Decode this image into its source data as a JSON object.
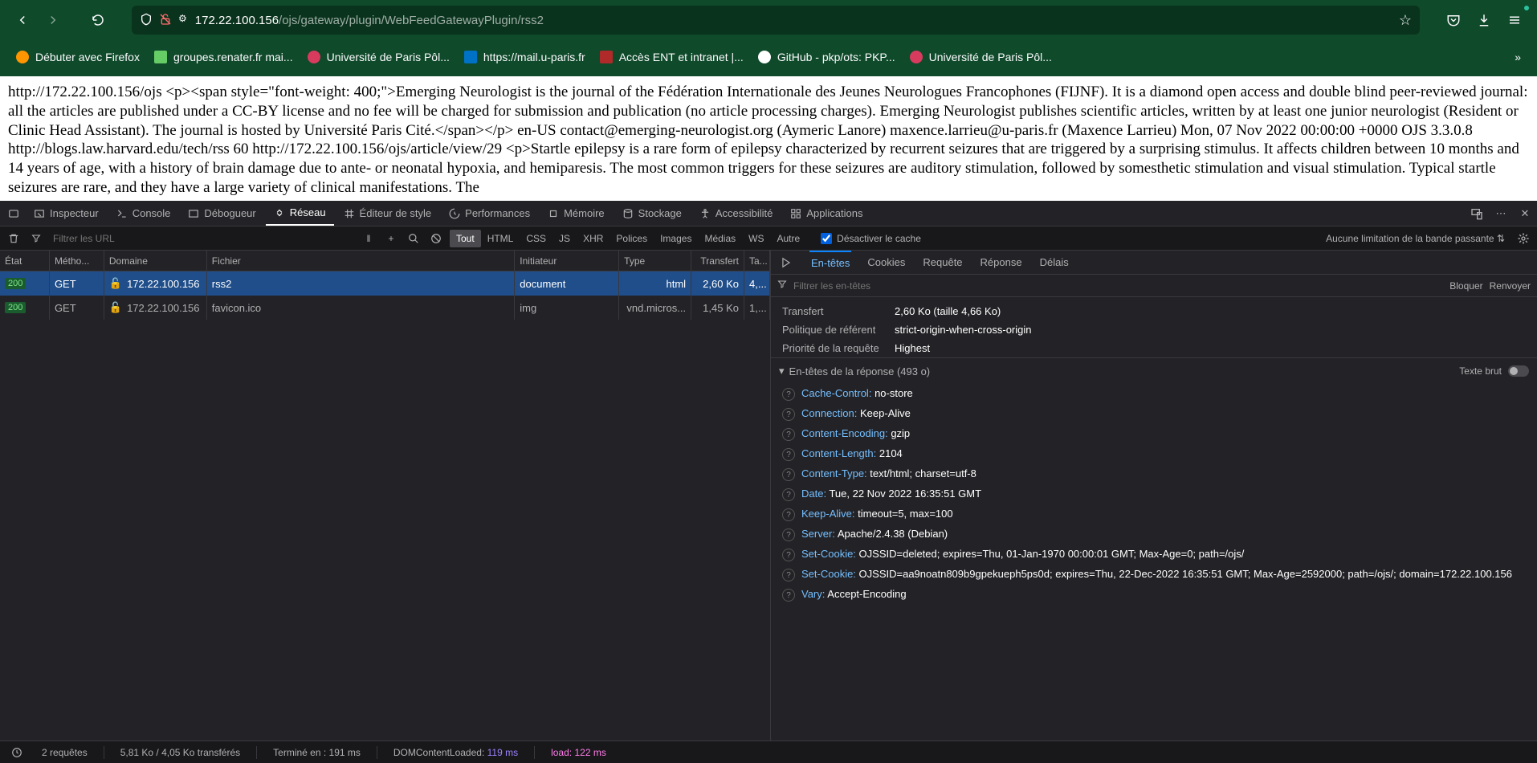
{
  "nav": {
    "url_host": "172.22.100.156",
    "url_path": "/ojs/gateway/plugin/WebFeedGatewayPlugin/rss2"
  },
  "bookmarks": [
    {
      "label": "Débuter avec Firefox",
      "color": "#ff9500"
    },
    {
      "label": "groupes.renater.fr mai...",
      "color": "#66cc66"
    },
    {
      "label": "Université de Paris Pôl...",
      "color": "#d83b5e"
    },
    {
      "label": "https://mail.u-paris.fr",
      "color": "#0072c6"
    },
    {
      "label": "Accès ENT et intranet |...",
      "color": "#b02a2a"
    },
    {
      "label": "GitHub - pkp/ots: PKP...",
      "color": "#24292e"
    },
    {
      "label": "Université de Paris Pôl...",
      "color": "#d83b5e"
    }
  ],
  "page_text": "http://172.22.100.156/ojs <p><span style=\"font-weight: 400;\">Emerging Neurologist is the journal of the Fédération Internationale des Jeunes Neurologues Francophones (FIJNF). It is a diamond open access and double blind peer-reviewed journal: all the articles are published under a CC-BY license and no fee will be charged for submission and publication (no article processing charges). Emerging Neurologist publishes scientific articles, written by at least one junior neurologist (Resident or Clinic Head Assistant). The journal is hosted by Université Paris Cité.</span></p> en-US contact@emerging-neurologist.org (Aymeric Lanore) maxence.larrieu@u-paris.fr (Maxence Larrieu) Mon, 07 Nov 2022 00:00:00 +0000 OJS 3.3.0.8 http://blogs.law.harvard.edu/tech/rss 60 http://172.22.100.156/ojs/article/view/29 <p>Startle epilepsy is a rare form of epilepsy characterized by recurrent seizures that are triggered by a surprising stimulus. It affects children between 10 months and 14 years of age, with a history of brain damage due to ante- or neonatal hypoxia, and hemiparesis. The most common triggers for these seizures are auditory stimulation, followed by somesthetic stimulation and visual stimulation. Typical startle seizures are rare, and they have a large variety of clinical manifestations. The",
  "dt_tabs": {
    "inspector": "Inspecteur",
    "console": "Console",
    "debugger": "Débogueur",
    "network": "Réseau",
    "style": "Éditeur de style",
    "perf": "Performances",
    "memory": "Mémoire",
    "storage": "Stockage",
    "a11y": "Accessibilité",
    "apps": "Applications"
  },
  "toolbar": {
    "filter_placeholder": "Filtrer les URL",
    "types": [
      "Tout",
      "HTML",
      "CSS",
      "JS",
      "XHR",
      "Polices",
      "Images",
      "Médias",
      "WS",
      "Autre"
    ],
    "disable_cache": "Désactiver le cache",
    "throttle": "Aucune limitation de la bande passante"
  },
  "columns": {
    "status": "État",
    "method": "Métho...",
    "domain": "Domaine",
    "file": "Fichier",
    "initiator": "Initiateur",
    "type": "Type",
    "transfer": "Transfert",
    "size": "Ta..."
  },
  "requests": [
    {
      "status": "200",
      "method": "GET",
      "domain": "172.22.100.156",
      "file": "rss2",
      "initiator": "document",
      "type": "html",
      "transfer": "2,60 Ko",
      "size": "4,..."
    },
    {
      "status": "200",
      "method": "GET",
      "domain": "172.22.100.156",
      "file": "favicon.ico",
      "initiator": "img",
      "type": "vnd.micros...",
      "transfer": "1,45 Ko",
      "size": "1,..."
    }
  ],
  "details": {
    "tabs": {
      "headers": "En-têtes",
      "cookies": "Cookies",
      "request": "Requête",
      "response": "Réponse",
      "timing": "Délais"
    },
    "filter_placeholder": "Filtrer les en-têtes",
    "block": "Bloquer",
    "resend": "Renvoyer",
    "summary": {
      "transfer_label": "Transfert",
      "transfer_value": "2,60 Ko (taille 4,66 Ko)",
      "referrer_label": "Politique de référent",
      "referrer_value": "strict-origin-when-cross-origin",
      "priority_label": "Priorité de la requête",
      "priority_value": "Highest"
    },
    "response_section": "En-têtes de la réponse (493 o)",
    "raw_label": "Texte brut",
    "headers": [
      {
        "name": "Cache-Control:",
        "value": "no-store"
      },
      {
        "name": "Connection:",
        "value": "Keep-Alive"
      },
      {
        "name": "Content-Encoding:",
        "value": "gzip"
      },
      {
        "name": "Content-Length:",
        "value": "2104"
      },
      {
        "name": "Content-Type:",
        "value": "text/html; charset=utf-8"
      },
      {
        "name": "Date:",
        "value": "Tue, 22 Nov 2022 16:35:51 GMT"
      },
      {
        "name": "Keep-Alive:",
        "value": "timeout=5, max=100"
      },
      {
        "name": "Server:",
        "value": "Apache/2.4.38 (Debian)"
      },
      {
        "name": "Set-Cookie:",
        "value": "OJSSID=deleted; expires=Thu, 01-Jan-1970 00:00:01 GMT; Max-Age=0; path=/ojs/"
      },
      {
        "name": "Set-Cookie:",
        "value": "OJSSID=aa9noatn809b9gpekueph5ps0d; expires=Thu, 22-Dec-2022 16:35:51 GMT; Max-Age=2592000; path=/ojs/; domain=172.22.100.156"
      },
      {
        "name": "Vary:",
        "value": "Accept-Encoding"
      }
    ]
  },
  "status_bar": {
    "requests": "2 requêtes",
    "transfer": "5,81 Ko / 4,05 Ko transférés",
    "finish": "Terminé en : 191 ms",
    "dcl_label": "DOMContentLoaded:",
    "dcl_value": "119 ms",
    "load_label": "load:",
    "load_value": "122 ms"
  }
}
